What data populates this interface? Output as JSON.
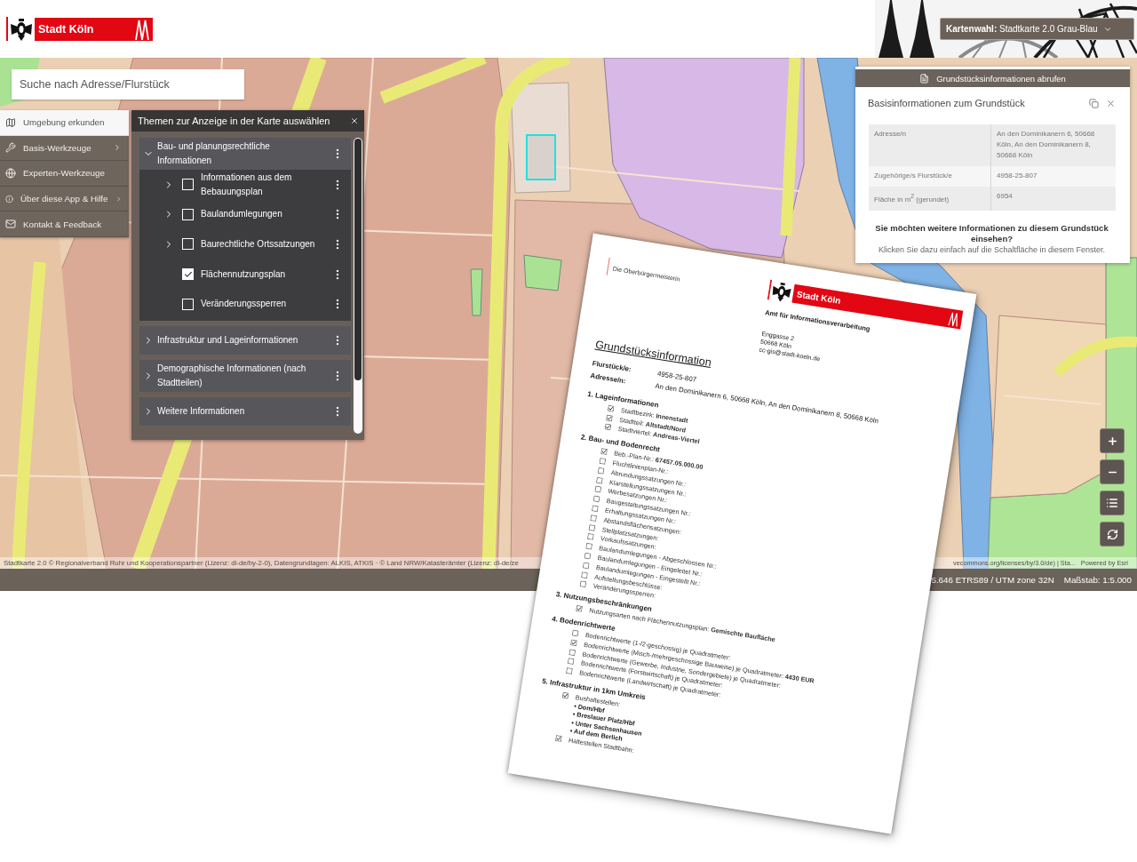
{
  "header": {
    "logo_text": "Stadt Köln",
    "basemap_select": "**Kartenwahl:**  Stadtkarte 2.0 Grau-Blau"
  },
  "search": {
    "placeholder": "Suche nach Adresse/Flurstück"
  },
  "menu": {
    "items": [
      {
        "label": "Umgebung erkunden",
        "selected": true,
        "submenu": false
      },
      {
        "label": "Basis-Werkzeuge",
        "selected": false,
        "submenu": true
      },
      {
        "label": "Experten-Werkzeuge",
        "selected": false,
        "submenu": false
      },
      {
        "label": "Über diese App & Hilfe",
        "selected": false,
        "submenu": true
      },
      {
        "label": "Kontakt & Feedback",
        "selected": false,
        "submenu": false
      }
    ]
  },
  "layers_panel": {
    "title": "Themen zur Anzeige in der Karte auswählen",
    "groups": [
      {
        "label": "Bau- und planungsrechtliche Informationen",
        "expanded": true,
        "children": [
          {
            "label": "Informationen aus dem Bebauungsplan",
            "checked": false,
            "expandable": true
          },
          {
            "label": "Baulandumlegungen",
            "checked": false,
            "expandable": true
          },
          {
            "label": "Baurechtliche Ortssatzungen",
            "checked": false,
            "expandable": true
          },
          {
            "label": "Flächennutzungsplan",
            "checked": true,
            "expandable": false
          },
          {
            "label": "Veränderungssperren",
            "checked": false,
            "expandable": false
          }
        ]
      },
      {
        "label": "Infrastruktur und Lageinformationen",
        "expanded": false
      },
      {
        "label": "Demographische Informationen (nach Stadtteilen)",
        "expanded": false
      },
      {
        "label": "Weitere Informationen",
        "expanded": false
      }
    ]
  },
  "info_panel": {
    "action": "Grundstücksinformationen abrufen",
    "title": "Basisinformationen zum Grundstück",
    "rows": [
      {
        "label": "Adresse/n",
        "value": "An den Dominikanern 6, 50668 Köln, An den Dominikanern 8, 50668 Köln"
      },
      {
        "label": "Zugehörige/s Flurstück/e",
        "value": "4958-25-807"
      },
      {
        "label": "Fläche in m$^{2}$ (gerundet)",
        "value": "6954"
      }
    ],
    "prompt": "Sie möchten weitere Informationen zu diesem Grundstück einsehen?",
    "hint": "Klicken Sie dazu einfach auf die Schaltfläche in diesem Fenster."
  },
  "attribution": {
    "left": "Stadtkarte 2.0 © Regionalverband Ruhr und Kooperationspartner (Lizenz: dl-de/by-2-0), Datengrundlagen: ALKIS, ATKIS · © Land NRW/Katasterämter (Lizenz: dl-de/ze",
    "right": "vecommons.org/licenses/by/3.0/de) | Sta...",
    "powered_by": "Powered by Esri"
  },
  "status_bar": {
    "coordinates": "5.646 ETRS89 / UTM zone 32N",
    "scale": "Maßstab: 1:5.000"
  },
  "document": {
    "note": "Die Oberbürgermeisterin",
    "logo_text": "Stadt Köln",
    "office": "Amt für Informationsverarbeitung",
    "address": [
      "Enggasse 2",
      "50668 Köln",
      "cc-gis@stadt-koeln.de"
    ],
    "title": "Grundstücksinformation",
    "fields": [
      "**Flurstück/e:** 4958-25-807",
      "**Adresse/n:** An den Dominikanern 6, 50668 Köln, An den Dominikanern 8, 50668 Köln"
    ],
    "sections": [
      {
        "heading": "1. Lageinformationen",
        "items": [
          {
            "text": "Stadtbezirk: **Innenstadt**",
            "checked": true
          },
          {
            "text": "Stadtteil: **Altstadt/Nord**",
            "checked": true
          },
          {
            "text": "Stadtviertel: **Andreas-Viertel**",
            "checked": true
          }
        ]
      },
      {
        "heading": "2. Bau- und Bodenrecht",
        "items": [
          {
            "text": "Beb.-Plan-Nr.: **67457.05.000.00**",
            "checked": true
          },
          {
            "text": "Fluchtlinienplan-Nr.:",
            "checked": false
          },
          {
            "text": "Abrundungssatzungen Nr.:",
            "checked": false
          },
          {
            "text": "Klarstellungssatzungen Nr.:",
            "checked": false
          },
          {
            "text": "Werbesatzungen Nr.:",
            "checked": false
          },
          {
            "text": "Baugestaltungssatzungen Nr.:",
            "checked": false
          },
          {
            "text": "Erhaltungssatzungen Nr.:",
            "checked": false
          },
          {
            "text": "Abstandsflächensatzungen:",
            "checked": false
          },
          {
            "text": "Stellplatzsatzungen:",
            "checked": false
          },
          {
            "text": "Vorkaufssatzungen:",
            "checked": false
          },
          {
            "text": "Baulandumlegungen - Abgeschlossen Nr.:",
            "checked": false
          },
          {
            "text": "Baulandumlegungen - Eingeleitet Nr.:",
            "checked": false
          },
          {
            "text": "Baulandumlegungen - Eingestellt Nr.:",
            "checked": false
          },
          {
            "text": "Aufstellungsbeschlüsse:",
            "checked": false
          },
          {
            "text": "Veränderungssperren:",
            "checked": false
          }
        ]
      },
      {
        "heading": "3. Nutzungsbeschränkungen",
        "items": [
          {
            "text": "Nutzungsarten nach Flächennutzungsplan: **Gemischte Baufläche**",
            "checked": true
          }
        ]
      },
      {
        "heading": "4. Bodenrichtwerte",
        "items": [
          {
            "text": "Bodenrichtwerte (1-/2-geschossig) je Quadratmeter:",
            "checked": false
          },
          {
            "text": "Bodenrichtwerte (Misch-/mehrgeschossige Bauweise) je Quadratmeter: **4430 EUR**",
            "checked": true
          },
          {
            "text": "Bodenrichtwerte (Gewerbe, Industrie, Sondergebiete) je Quadratmeter:",
            "checked": false
          },
          {
            "text": "Bodenrichtwerte (Forstwirtschaft) je Quadratmeter:",
            "checked": false
          },
          {
            "text": "Bodenrichtwerte (Landwirtschaft) je Quadratmeter:",
            "checked": false
          }
        ]
      },
      {
        "heading": "5. Infrastruktur in 1km Umkreis",
        "items": [
          {
            "text": "Bushaltestellen:",
            "checked": true,
            "list": [
              "• Dom/Hbf",
              "• Breslauer Platz/Hbf",
              "• Unter Sachsenhausen",
              "• Auf dem Berlich"
            ]
          },
          {
            "text": "Haltestellen Stadtbahn:",
            "checked": true
          }
        ]
      }
    ]
  }
}
